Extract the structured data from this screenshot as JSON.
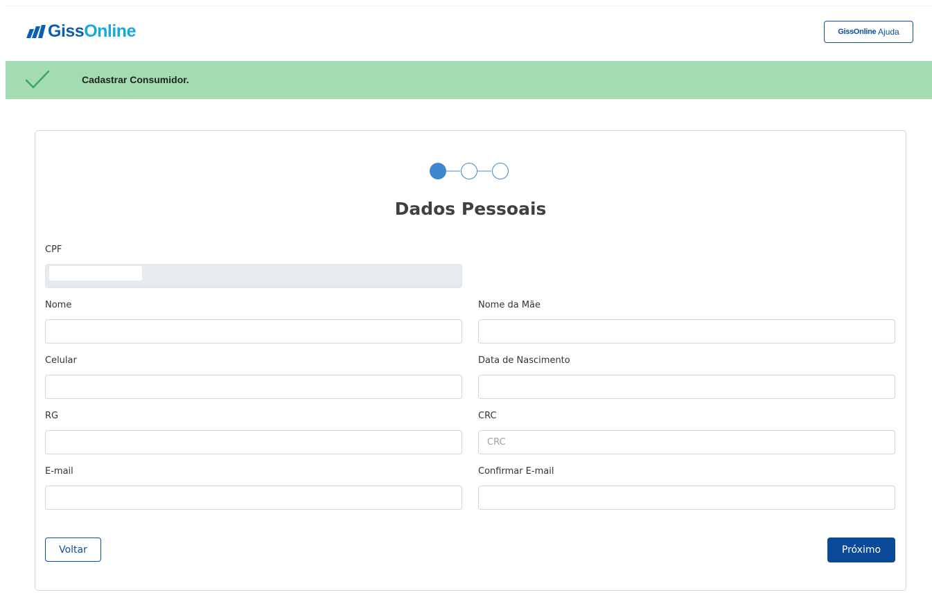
{
  "header": {
    "logo": {
      "part1": "Giss",
      "part2": "Online"
    },
    "help_button": {
      "brand_part1": "Giss",
      "brand_part2": "Online",
      "label": " Ajuda"
    }
  },
  "banner": {
    "message": "Cadastrar Consumidor.",
    "color": "#a3dcb0"
  },
  "stepper": {
    "total_steps": 3,
    "current_step": 1
  },
  "form": {
    "title": "Dados Pessoais",
    "fields": {
      "cpf": {
        "label": "CPF",
        "value": "",
        "disabled": true
      },
      "nome": {
        "label": "Nome",
        "value": ""
      },
      "nome_mae": {
        "label": "Nome da Mãe",
        "value": ""
      },
      "celular": {
        "label": "Celular",
        "value": ""
      },
      "data_nascimento": {
        "label": "Data de Nascimento",
        "value": ""
      },
      "rg": {
        "label": "RG",
        "value": ""
      },
      "crc": {
        "label": "CRC",
        "value": "",
        "placeholder": "CRC"
      },
      "email": {
        "label": "E-mail",
        "value": ""
      },
      "confirmar_email": {
        "label": "Confirmar E-mail",
        "value": ""
      }
    },
    "buttons": {
      "back": "Voltar",
      "next": "Próximo"
    }
  },
  "colors": {
    "primary": "#0a4a98",
    "step_active": "#3f88cf",
    "logo_dark": "#0a5fb0",
    "logo_light": "#18a8e0"
  }
}
